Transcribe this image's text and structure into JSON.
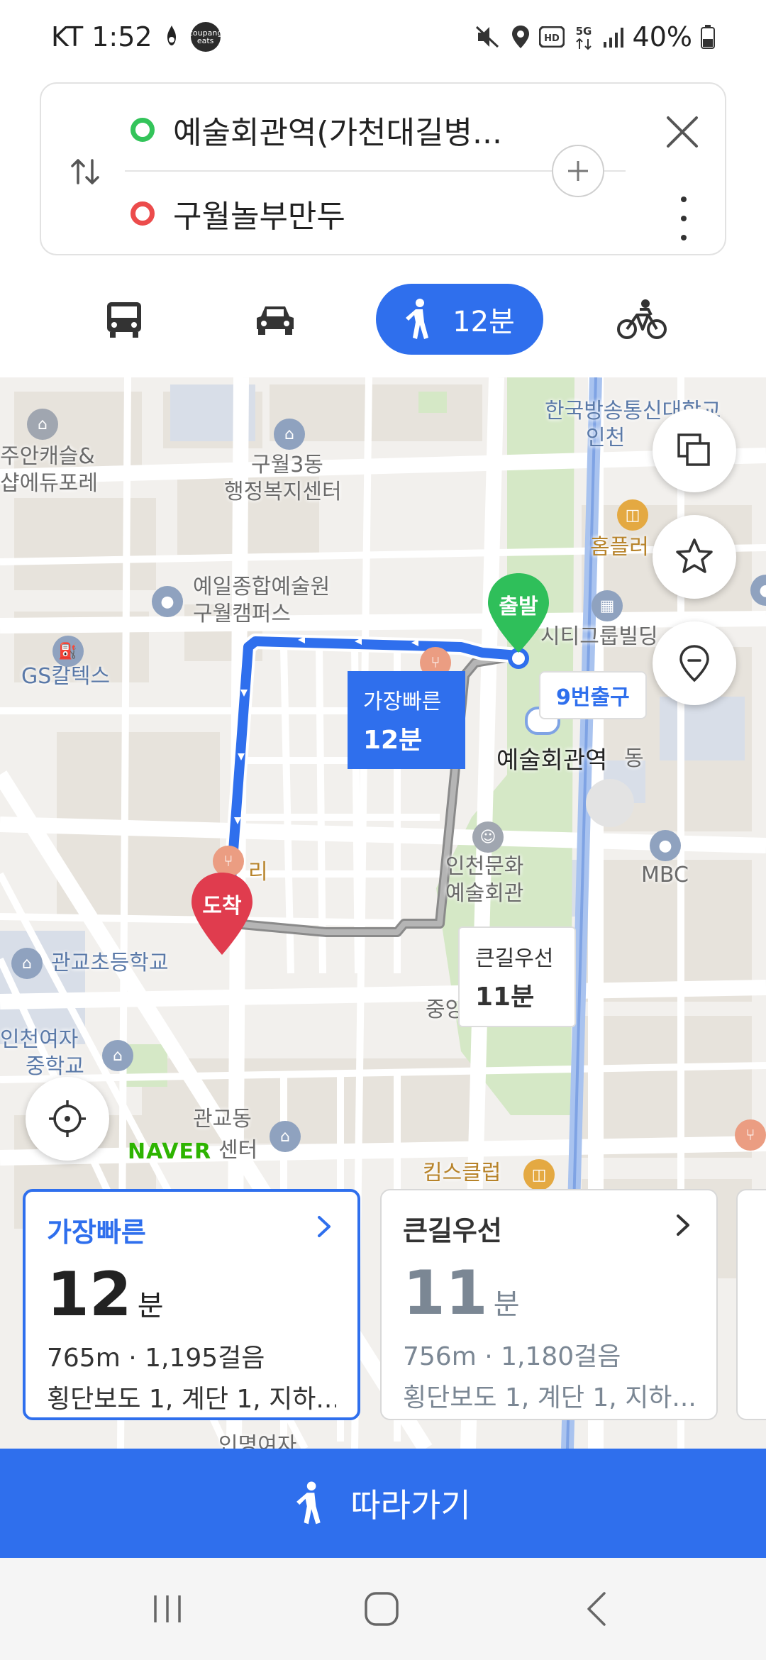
{
  "status_bar": {
    "carrier_time": "KT 1:52",
    "app_badge": "coupang eats",
    "battery": "40%",
    "icons": [
      "mute-icon",
      "location-icon",
      "hd-icon",
      "5g-icon",
      "signal-icon",
      "battery-icon"
    ]
  },
  "search": {
    "origin": "예술회관역(가천대길병...",
    "destination": "구월놀부만두",
    "icons": [
      "swap-icon",
      "add-icon",
      "close-icon",
      "more-icon"
    ]
  },
  "modes": {
    "walk_time": "12분",
    "icons": [
      "bus-icon",
      "car-icon",
      "walk-icon",
      "bike-icon"
    ]
  },
  "map": {
    "labels": {
      "kbs": "한국방송통신대학교",
      "kbs2": "인천",
      "jooan": "주안캐슬&",
      "jooan2": "샵에듀포레",
      "guwol3": "구월3동",
      "guwol3b": "행정복지센터",
      "homeplus": "홈플러",
      "yeil": "예일종합예술원",
      "yeil2": "구월캠퍼스",
      "city": "시티그룹빌딩",
      "gs": "GS칼텍스",
      "station": "예술회관역",
      "dong": "동",
      "mbc": "MBC",
      "culture": "인천문화",
      "culture2": "예술회관",
      "ri": "리",
      "gwangyo_school": "관교초등학교",
      "central_park": "중앙공원",
      "girls": "인천여자",
      "girls2": "중학교",
      "gwangyo_dong": "관교동",
      "center": "센터",
      "kims": "킴스클럽",
      "inmyeong": "인명여자"
    },
    "start_marker": "출발",
    "end_marker": "도착",
    "exit_label": "9번출구",
    "fast_bubble": {
      "label": "가장빠른",
      "time": "12분"
    },
    "alt_bubble": {
      "label": "큰길우선",
      "time": "11분"
    },
    "naver_logo": "NAVER",
    "colors": {
      "route": "#2f6fed",
      "alt_route": "#8a8a8a",
      "park": "#d5e8c6",
      "rail": "#a9c3ef"
    }
  },
  "cards": [
    {
      "title": "가장빠른",
      "time": "12",
      "unit": "분",
      "distance": "765m · 1,195걸음",
      "info": "횡단보도 1, 계단 1, 지하..."
    },
    {
      "title": "큰길우선",
      "time": "11",
      "unit": "분",
      "distance": "756m · 1,180걸음",
      "info": "횡단보도 1, 계단 1, 지하..."
    }
  ],
  "follow_button": "따라가기"
}
